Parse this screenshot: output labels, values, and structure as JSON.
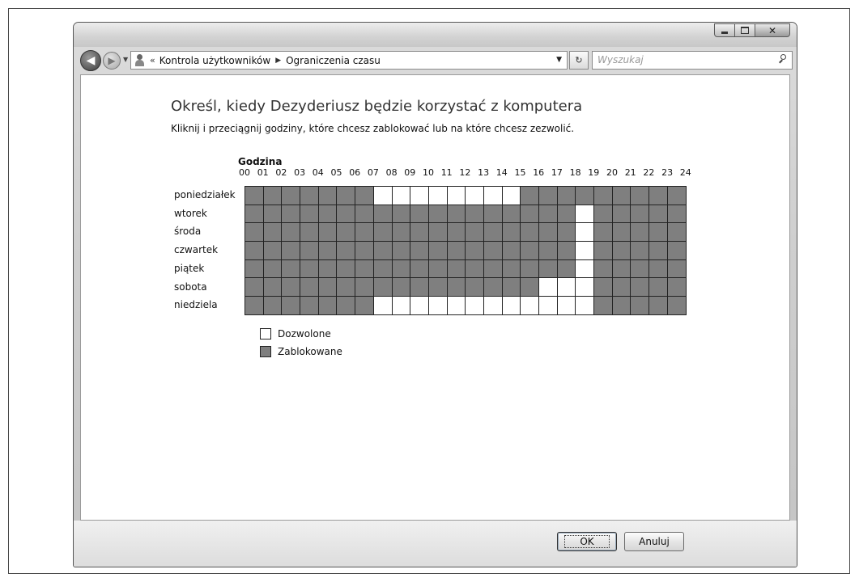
{
  "window": {
    "controls": {
      "minimize_icon": "minimize-icon",
      "maximize_icon": "maximize-icon",
      "close_icon": "close-icon"
    }
  },
  "navigation": {
    "back_icon": "back-arrow-icon",
    "forward_icon": "forward-arrow-icon",
    "breadcrumb": {
      "chevron": "«",
      "items": [
        "Kontrola użytkowników",
        "Ograniczenia czasu"
      ],
      "separator": "▶"
    },
    "dropdown_glyph": "▼",
    "refresh_glyph": "↻",
    "search": {
      "placeholder": "Wyszukaj"
    }
  },
  "main": {
    "heading": "Określ, kiedy Dezyderiusz będzie korzystać z komputera",
    "instruction": "Kliknij i przeciągnij godziny, które chcesz zablokować lub na które chcesz zezwolić.",
    "hour_title": "Godzina",
    "hours": [
      "00",
      "01",
      "02",
      "03",
      "04",
      "05",
      "06",
      "07",
      "08",
      "09",
      "10",
      "11",
      "12",
      "13",
      "14",
      "15",
      "16",
      "17",
      "18",
      "19",
      "20",
      "21",
      "22",
      "23",
      "24"
    ],
    "days": [
      "poniedziałek",
      "wtorek",
      "środa",
      "czwartek",
      "piątek",
      "sobota",
      "niedziela"
    ],
    "schedule": [
      "BBBBBBBAAAAAAAABBBBBBBBB",
      "BBBBBBBBBBBBBBBBBBABBBBB",
      "BBBBBBBBBBBBBBBBBBABBBBB",
      "BBBBBBBBBBBBBBBBBBABBBBB",
      "BBBBBBBBBBBBBBBBBBABBBBB",
      "BBBBBBBBBBBBBBBBAAABBBBB",
      "BBBBBBBAAAAAAAAAAAABBBBB"
    ],
    "legend": {
      "allowed": "Dozwolone",
      "blocked": "Zablokowane"
    },
    "colors": {
      "allowed": "#ffffff",
      "blocked": "#7f7f7f"
    }
  },
  "footer": {
    "ok_label": "OK",
    "cancel_label": "Anuluj"
  }
}
